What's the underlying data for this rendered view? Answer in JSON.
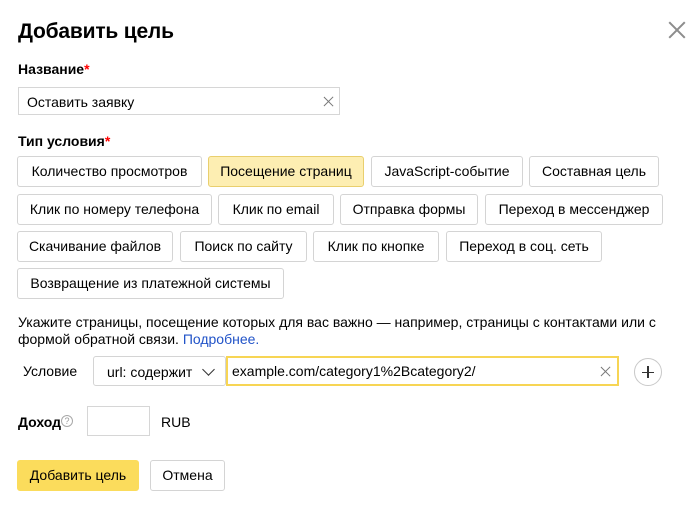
{
  "dialog": {
    "title": "Добавить цель",
    "close_icon": "close-icon"
  },
  "name": {
    "label": "Название",
    "required_mark": "*",
    "value": "Оставить заявку"
  },
  "condition_type": {
    "label": "Тип условия",
    "required_mark": "*",
    "options": [
      "Количество просмотров",
      "Посещение страниц",
      "JavaScript-событие",
      "Составная цель",
      "Клик по номеру телефона",
      "Клик по email",
      "Отправка формы",
      "Переход в мессенджер",
      "Скачивание файлов",
      "Поиск по сайту",
      "Клик по кнопке",
      "Переход в соц. сеть",
      "Возвращение из платежной системы"
    ],
    "selected": "Посещение страниц"
  },
  "hint": {
    "text": "Укажите страницы, посещение которых для вас важно — например, страницы с контактами или с формой обратной связи. ",
    "link": "Подробнее."
  },
  "condition": {
    "label": "Условие",
    "operator": "url: содержит",
    "value": "example.com/category1%2Bcategory2/"
  },
  "income": {
    "label": "Доход",
    "help_icon": "question-icon",
    "help_glyph": "?",
    "value": "",
    "currency": "RUB"
  },
  "buttons": {
    "submit": "Добавить цель",
    "cancel": "Отмена"
  },
  "colors": {
    "accent": "#fbdc5c",
    "selected_chip": "#fdeeb2",
    "link": "#2153c8",
    "required": "#ff0000"
  }
}
